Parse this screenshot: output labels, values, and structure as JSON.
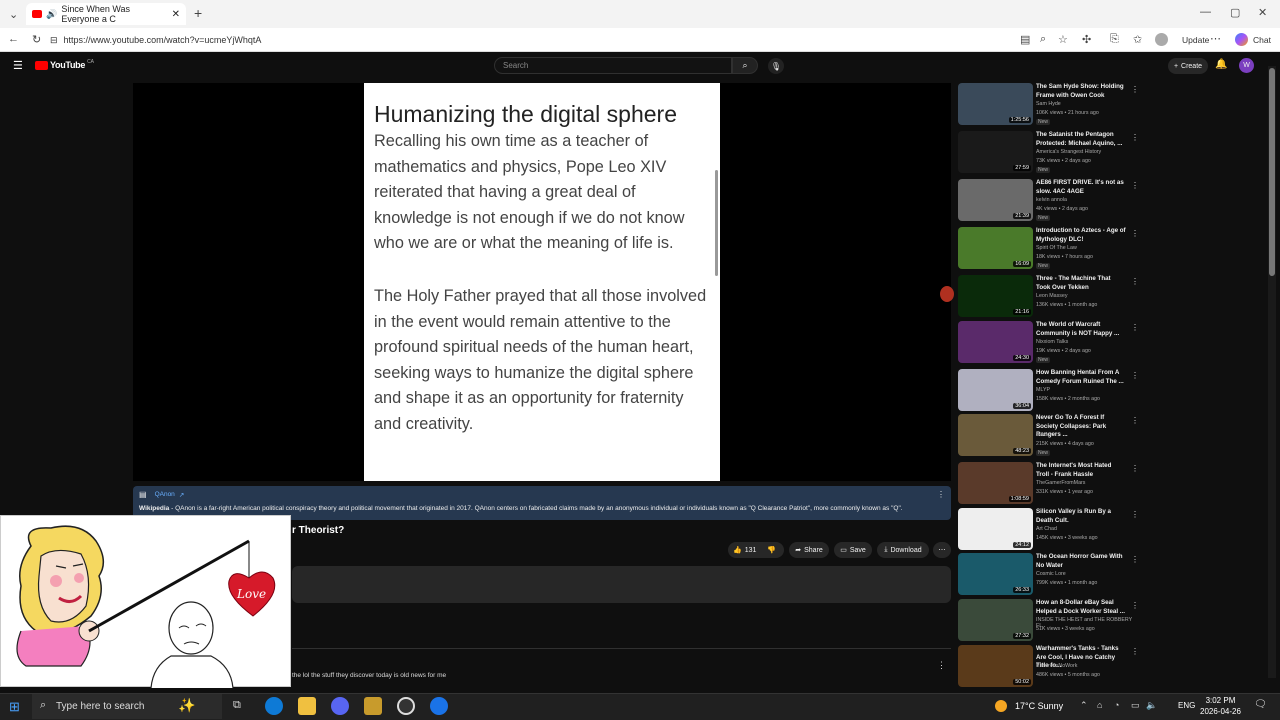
{
  "browser": {
    "tab_title": "Since When Was Everyone a C",
    "url": "https://www.youtube.com/watch?v=ucmeYjWhqtA",
    "update_label": "Update",
    "chat_label": "Chat"
  },
  "header": {
    "logo": "YouTube",
    "logo_region": "CA",
    "search_placeholder": "Search",
    "create_label": "Create",
    "avatar_letter": "W"
  },
  "slide": {
    "heading": "Humanizing the digital sphere",
    "para1": "Recalling his own time as a teacher of mathematics and physics, Pope Leo XIV reiterated that having a great deal of knowledge is not enough if we do not know who we are or what the meaning of life is.",
    "para2": "The Holy Father prayed that all those involved in the event would remain attentive to the profound spiritual needs of the human heart, seeking ways to humanize the digital sphere and shape it as an opportunity for fraternity and creativity."
  },
  "wiki": {
    "topic": "QAnon",
    "source": "Wikipedia",
    "text": "QAnon is a far-right American political conspiracy theory and political movement that originated in 2017. QAnon centers on fabricated claims made by an anonymous individual or individuals known as \"Q Clearance Patriot\", more commonly known as \"Q\"."
  },
  "video": {
    "title_fragment": "r Theorist?",
    "likes": "131",
    "share_label": "Share",
    "save_label": "Save",
    "download_label": "Download"
  },
  "comment": {
    "text": "the lol the stuff they discover today is old news for me"
  },
  "comic": {
    "heart_text": "Love"
  },
  "recommendations": [
    {
      "title": "The Sam Hyde Show: Holding Frame with Owen Cook",
      "channel": "Sam Hyde",
      "meta": "106K views • 21 hours ago",
      "badge": "New",
      "duration": "1:25:56",
      "color": "#3a4a5a"
    },
    {
      "title": "The Satanist the Pentagon Protected: Michael Aquino, ...",
      "channel": "America's Strangest History",
      "meta": "73K views • 2 days ago",
      "badge": "New",
      "duration": "27:59",
      "color": "#1a1a1a"
    },
    {
      "title": "AE86 FIRST DRIVE. It's not as slow. 4AC 4AGE",
      "channel": "kelvin annola",
      "meta": "4K views • 2 days ago",
      "badge": "New",
      "duration": "21:39",
      "color": "#6a6a6a"
    },
    {
      "title": "Introduction to Aztecs - Age of Mythology DLC!",
      "channel": "Spirit Of The Law",
      "meta": "18K views • 7 hours ago",
      "badge": "New",
      "duration": "16:09",
      "color": "#4a7a2a"
    },
    {
      "title": "Three - The Machine That Took Over Tekken",
      "channel": "Leon Massey",
      "meta": "136K views • 1 month ago",
      "badge": "",
      "duration": "21:16",
      "color": "#0a2a0a"
    },
    {
      "title": "The World of Warcraft Community is NOT Happy ...",
      "channel": "Nixxiom Talks",
      "meta": "19K views • 2 days ago",
      "badge": "New",
      "duration": "24:30",
      "color": "#5a2a6a"
    },
    {
      "title": "How Banning Hentai From A Comedy Forum Ruined The ...",
      "channel": "MLYP",
      "meta": "158K views • 2 months ago",
      "badge": "",
      "duration": "36:04",
      "color": "#b0b0c0"
    },
    {
      "title": "Never Go To A Forest If Society Collapses: Park Rangers ...",
      "channel": "Slezlor",
      "meta": "215K views • 4 days ago",
      "badge": "New",
      "duration": "48:23",
      "color": "#6a5a3a"
    },
    {
      "title": "The Internet's Most Hated Troll - Frank Hassle",
      "channel": "TheGamerFromMars",
      "meta": "331K views • 1 year ago",
      "badge": "",
      "duration": "1:08:59",
      "color": "#5a3a2a"
    },
    {
      "title": "Silicon Valley is Run By a Death Cult.",
      "channel": "Art Chad",
      "meta": "145K views • 3 weeks ago",
      "badge": "",
      "duration": "24:12",
      "color": "#eeeeee"
    },
    {
      "title": "The Ocean Horror Game With No Water",
      "channel": "Cosmic Lore",
      "meta": "799K views • 1 month ago",
      "badge": "",
      "duration": "26:33",
      "color": "#1a5a6a"
    },
    {
      "title": "How an 8-Dollar eBay Seal Helped a Dock Worker Steal ...",
      "channel": "INSIDE THE HEIST and THE ROBBERY FI...",
      "meta": "51K views • 3 weeks ago",
      "badge": "",
      "duration": "27:32",
      "color": "#3a4a3a"
    },
    {
      "title": "Warhammer's Tanks - Tanks Are Cool, I Have no Catchy Title fo...",
      "channel": "PancreasNoWork",
      "meta": "486K views • 5 months ago",
      "badge": "",
      "duration": "50:02",
      "color": "#5a3a1a"
    }
  ],
  "taskbar": {
    "search_placeholder": "Type here to search",
    "weather": "17°C  Sunny",
    "lang": "ENG",
    "time": "3:02 PM",
    "date": "2026-04-26"
  }
}
